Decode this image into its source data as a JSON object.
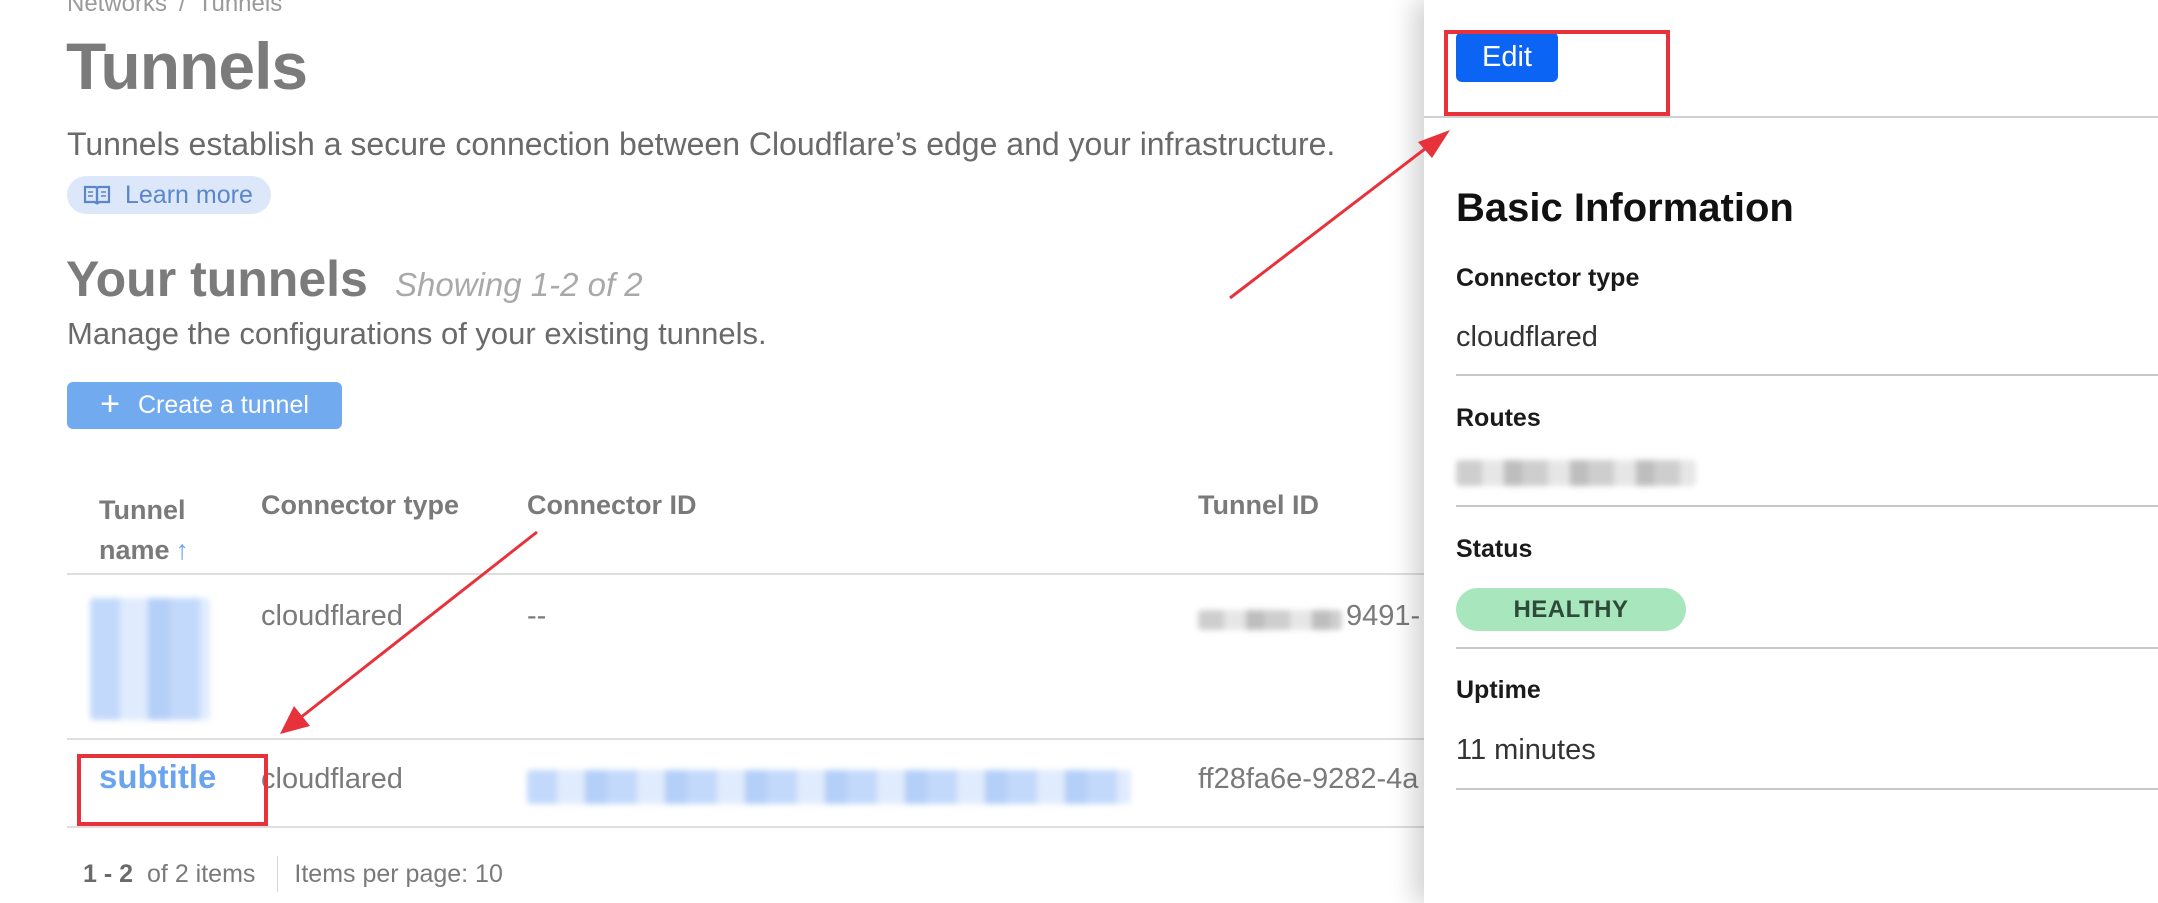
{
  "breadcrumb": {
    "parent": "Networks",
    "separator": "/",
    "current": "Tunnels"
  },
  "page": {
    "title": "Tunnels",
    "description": "Tunnels establish a secure connection between Cloudflare’s edge and your infrastructure.",
    "learn_more": "Learn more"
  },
  "section": {
    "title": "Your tunnels",
    "showing": "Showing 1-2 of 2",
    "description": "Manage the configurations of your existing tunnels.",
    "create_button": "Create a tunnel"
  },
  "table": {
    "headers": {
      "tunnel_name_line1": "Tunnel",
      "tunnel_name_line2": "name",
      "sort_indicator": "↑",
      "connector_type": "Connector type",
      "connector_id": "Connector ID",
      "tunnel_id": "Tunnel ID"
    },
    "rows": [
      {
        "name": "",
        "connector_type": "cloudflared",
        "connector_id": "--",
        "tunnel_id": "9491-"
      },
      {
        "name": "subtitle",
        "connector_type": "cloudflared",
        "connector_id": "",
        "tunnel_id": "ff28fa6e-9282-4a"
      }
    ]
  },
  "pagination": {
    "range": "1 - 2",
    "of_items": "of 2 items",
    "per_page": "Items per page: 10"
  },
  "panel": {
    "edit_button": "Edit",
    "heading": "Basic Information",
    "connector_type_label": "Connector type",
    "connector_type_value": "cloudflared",
    "routes_label": "Routes",
    "status_label": "Status",
    "status_value": "HEALTHY",
    "uptime_label": "Uptime",
    "uptime_value": "11 minutes"
  },
  "colors": {
    "primary_button": "#0b64f3",
    "link": "#6aa4ee",
    "healthy_badge": "#a8e6be",
    "annotation_red": "#e8323b"
  },
  "icons": [
    "book-icon",
    "plus-icon",
    "sort-ascending-icon"
  ]
}
